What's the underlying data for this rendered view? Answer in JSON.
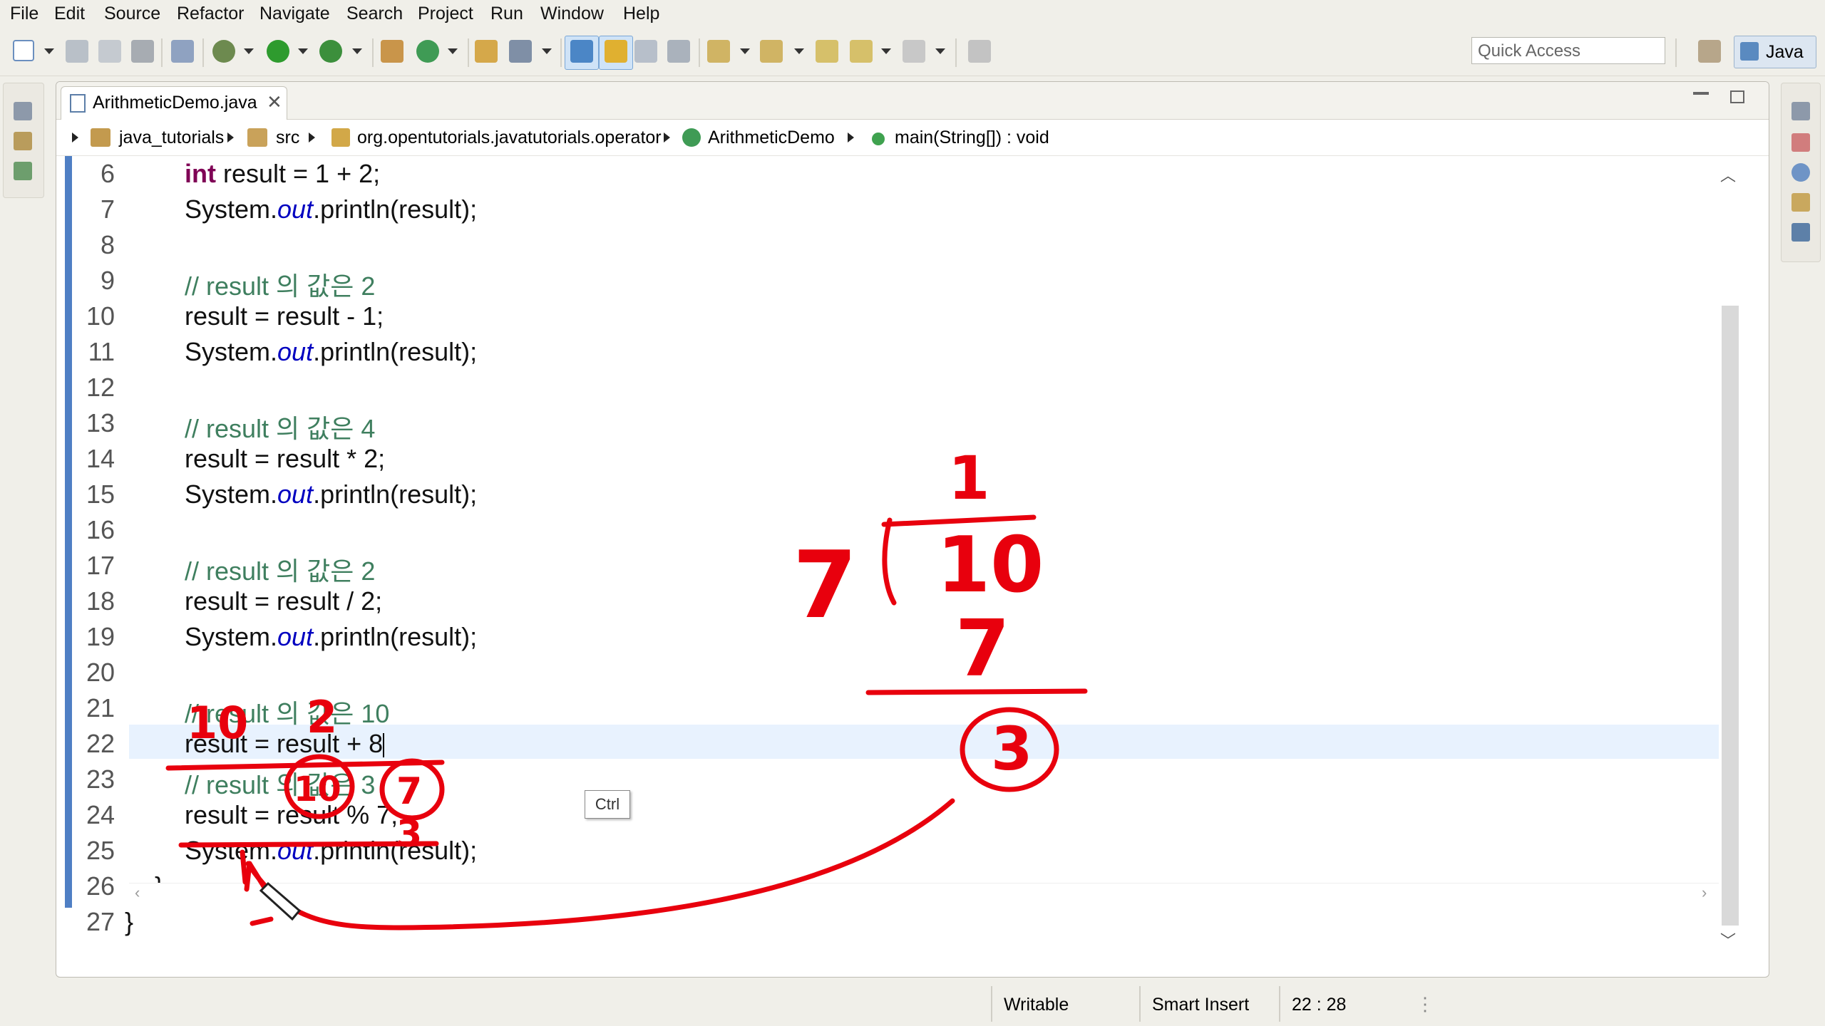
{
  "menu": [
    "File",
    "Edit",
    "Source",
    "Refactor",
    "Navigate",
    "Search",
    "Project",
    "Run",
    "Window",
    "Help"
  ],
  "toolbar": {
    "quick_access_placeholder": "Quick Access",
    "perspective_label": "Java"
  },
  "editor": {
    "tab_title": "ArithmeticDemo.java",
    "breadcrumb": [
      "java_tutorials",
      "src",
      "org.opentutorials.javatutorials.operator",
      "ArithmeticDemo",
      "main(String[]) : void"
    ],
    "current_line": 22
  },
  "code_lines": [
    {
      "num": "6",
      "parts": [
        {
          "cls": "kw",
          "text": "int"
        },
        {
          "cls": "",
          "text": " result = 1 + 2;"
        }
      ]
    },
    {
      "num": "7",
      "parts": [
        {
          "cls": "",
          "text": "System."
        },
        {
          "cls": "fld",
          "text": "out"
        },
        {
          "cls": "",
          "text": ".println(result);"
        }
      ]
    },
    {
      "num": "8",
      "parts": []
    },
    {
      "num": "9",
      "parts": [
        {
          "cls": "cmt",
          "text": "// result 의 값은 2"
        }
      ]
    },
    {
      "num": "10",
      "parts": [
        {
          "cls": "",
          "text": "result = result - 1;"
        }
      ]
    },
    {
      "num": "11",
      "parts": [
        {
          "cls": "",
          "text": "System."
        },
        {
          "cls": "fld",
          "text": "out"
        },
        {
          "cls": "",
          "text": ".println(result);"
        }
      ]
    },
    {
      "num": "12",
      "parts": []
    },
    {
      "num": "13",
      "parts": [
        {
          "cls": "cmt",
          "text": "// result 의 값은 4"
        }
      ]
    },
    {
      "num": "14",
      "parts": [
        {
          "cls": "",
          "text": "result = result * 2;"
        }
      ]
    },
    {
      "num": "15",
      "parts": [
        {
          "cls": "",
          "text": "System."
        },
        {
          "cls": "fld",
          "text": "out"
        },
        {
          "cls": "",
          "text": ".println(result);"
        }
      ]
    },
    {
      "num": "16",
      "parts": []
    },
    {
      "num": "17",
      "parts": [
        {
          "cls": "cmt",
          "text": "// result 의 값은 2"
        }
      ]
    },
    {
      "num": "18",
      "parts": [
        {
          "cls": "",
          "text": "result = result / 2;"
        }
      ]
    },
    {
      "num": "19",
      "parts": [
        {
          "cls": "",
          "text": "System."
        },
        {
          "cls": "fld",
          "text": "out"
        },
        {
          "cls": "",
          "text": ".println(result);"
        }
      ]
    },
    {
      "num": "20",
      "parts": []
    },
    {
      "num": "21",
      "parts": [
        {
          "cls": "cmt",
          "text": "// result 의 값은 10"
        }
      ]
    },
    {
      "num": "22",
      "parts": [
        {
          "cls": "",
          "text": "result = result + 8"
        }
      ],
      "caret": true
    },
    {
      "num": "23",
      "parts": [
        {
          "cls": "cmt",
          "text": "// result 의 값은 3"
        }
      ]
    },
    {
      "num": "24",
      "parts": [
        {
          "cls": "",
          "text": "result = result % 7;"
        }
      ]
    },
    {
      "num": "25",
      "parts": [
        {
          "cls": "",
          "text": "System."
        },
        {
          "cls": "fld",
          "text": "out"
        },
        {
          "cls": "",
          "text": ".println(result);"
        }
      ]
    },
    {
      "num": "26",
      "parts": [
        {
          "cls": "",
          "text": "}"
        }
      ],
      "indent": "method"
    },
    {
      "num": "27",
      "parts": [
        {
          "cls": "",
          "text": "}"
        }
      ],
      "indent": "class"
    }
  ],
  "tooltip": "Ctrl",
  "status": {
    "writable": "Writable",
    "insert_mode": "Smart Insert",
    "position": "22 : 28"
  },
  "annotations": {
    "color": "#e8000d",
    "texts": [
      "10",
      "2",
      "10",
      "7",
      "3",
      "7",
      "1",
      "10",
      "7",
      "3"
    ]
  },
  "colors": {
    "keyword": "#7f0055",
    "field": "#0000c0",
    "comment": "#3f7f5f",
    "current_line": "#e8f2fe",
    "annotation": "#e8000d"
  }
}
